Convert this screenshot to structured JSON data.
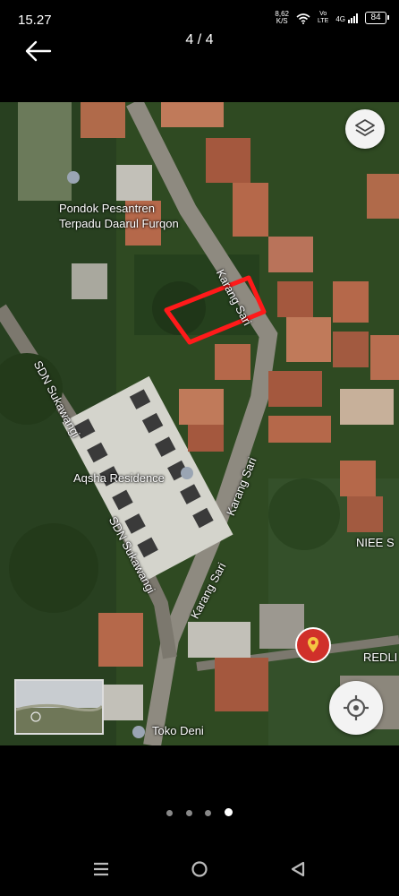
{
  "status_bar": {
    "time": "15.27",
    "net_speed_value": "8,62",
    "net_speed_unit": "K/S",
    "volte_line1": "Vo",
    "volte_line2": "LTE",
    "signal_label": "4G",
    "battery": "84",
    "icons": [
      "wifi-icon",
      "signal-icon",
      "battery-icon"
    ]
  },
  "viewer": {
    "current": "4",
    "separator": "/",
    "total": "4",
    "page_dots": 4,
    "active_dot": 4
  },
  "map": {
    "labels": {
      "pondok_line1": "Pondok Pesantren",
      "pondok_line2": "Terpadu Daarul Furqon",
      "karang_sari_top": "Karang Sari",
      "karang_sari_mid": "Karang Sari",
      "karang_sari_bottom": "Karang Sari",
      "sdn_upper": "SDN Sukawangi",
      "sdn_lower": "SDN Sukawangi",
      "aqsha": "Aqsha Residence",
      "niee": "NIEE S",
      "redli": "REDLI",
      "toko": "Toko Deni"
    },
    "highlight_color": "#ff1a1a",
    "controls": [
      "layers-icon",
      "my-location-icon",
      "location-pin-icon"
    ]
  },
  "colors": {
    "foliage": "#2f4a22",
    "roof": "#b5684a",
    "road": "#8e8a80"
  },
  "nav_bar": {
    "icons": [
      "recents-icon",
      "home-icon",
      "back-triangle-icon"
    ]
  }
}
